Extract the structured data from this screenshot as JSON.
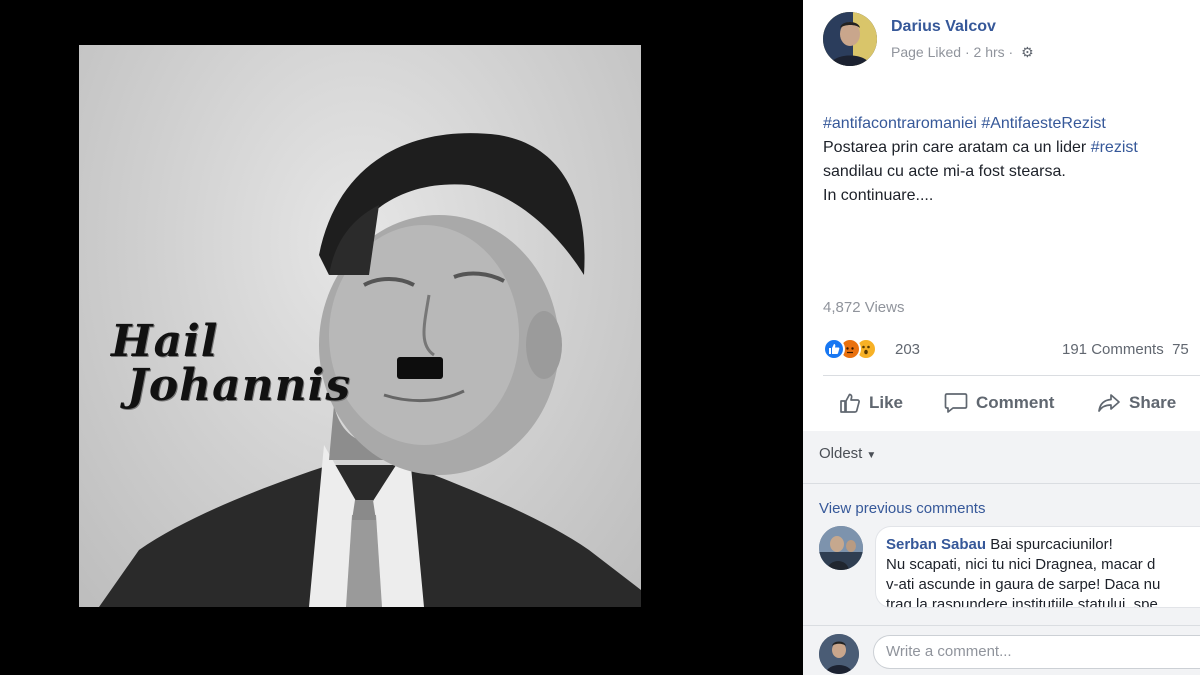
{
  "photo": {
    "art_text_line1": "Hail",
    "art_text_line2": "Johannis"
  },
  "post": {
    "author": "Darius Valcov",
    "meta_status": "Page Liked",
    "meta_separator": "·",
    "meta_time": "2 hrs",
    "meta_separator2": "·",
    "hashtag1": "#antifacontraromaniei",
    "hashtag2": "#AntifaesteRezist",
    "line2_text": "Postarea prin care aratam ca un lider ",
    "line2_tag": "#rezist",
    "line3_text": "sandilau cu acte mi-a fost stearsa.",
    "line4_text": "In continuare....",
    "views": "4,872 Views",
    "reaction_count": "203",
    "comments_count": "191 Comments",
    "shares_partial": "75",
    "action_like": "Like",
    "action_comment": "Comment",
    "action_share": "Share"
  },
  "comments": {
    "sort_label": "Oldest",
    "view_previous": "View previous comments",
    "items": [
      {
        "author": "Serban Sabau",
        "first_text": " Bai spurcaciunilor!",
        "line2": "Nu scapati, nici tu nici Dragnea, macar d",
        "line3": "v-ati ascunde in gaura de sarpe! Daca nu",
        "line4": "trag la raspundere institutiile statului, spe"
      }
    ],
    "write_placeholder": "Write a comment..."
  },
  "colors": {
    "link_blue": "#365899",
    "like_blue": "#1877f2",
    "angry_orange": "#e9710f",
    "wow_yellow": "#f7b125"
  }
}
